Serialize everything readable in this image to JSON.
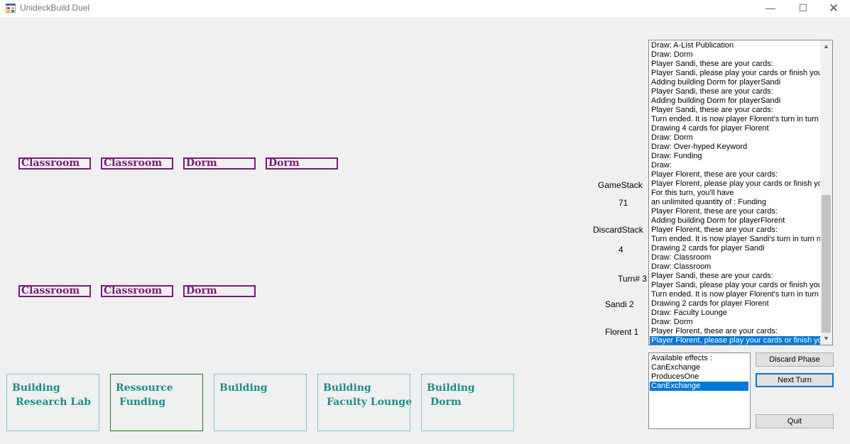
{
  "window": {
    "title": "UnideckBuild Duel",
    "minimize": "—",
    "maximize": "☐",
    "close": "✕"
  },
  "top_cards": [
    "Classroom",
    "Classroom",
    "Dorm",
    "Dorm"
  ],
  "bottom_cards": [
    "Classroom",
    "Classroom",
    "Dorm"
  ],
  "stats": {
    "game_stack_label": "GameStack",
    "game_stack_value": "71",
    "discard_stack_label": "DiscardStack",
    "discard_stack_value": "4",
    "turn": "Turn# 3",
    "player1": "Sandi 2",
    "player2": "Florent 1"
  },
  "log": [
    "Draw: A-List Publication",
    "Draw: Dorm",
    "Player Sandi, these are your cards:",
    "Player Sandi, please play your cards or finish your t",
    "Adding building Dorm for playerSandi",
    "Player Sandi, these are your cards:",
    "Adding building Dorm for playerSandi",
    "Player Sandi, these are your cards:",
    "Turn ended. It is now player Florent's turn in turn nu",
    "Drawing 4 cards for player Florent",
    "Draw: Dorm",
    "Draw: Over-hyped Keyword",
    "Draw: Funding",
    "Draw:",
    "Player Florent, these are your cards:",
    "Player Florent, please play your cards or finish your",
    "For this turn, you'll have",
    " an unlimited quantity of : Funding",
    "Player Florent, these are your cards:",
    "Adding building Dorm for playerFlorent",
    "Player Florent, these are your cards:",
    "Turn ended. It is now player Sandi's turn in turn nur",
    "Drawing 2 cards for player Sandi",
    "Draw: Classroom",
    "Draw: Classroom",
    "Player Sandi, these are your cards:",
    "Player Sandi, please play your cards or finish your t",
    "Turn ended. It is now player Florent's turn in turn nu",
    "Drawing 2 cards for player Florent",
    "Draw: Faculty Lounge",
    "Draw: Dorm",
    "Player Florent, these are your cards:",
    "Player Florent, please play your cards or finish your"
  ],
  "log_selected_index": 32,
  "effects": [
    "Available effects :",
    "CanExchange",
    "ProducesOne",
    "CanExchange"
  ],
  "effects_selected_index": 3,
  "buttons": {
    "discard": "Discard Phase",
    "next": "Next Turn",
    "quit": "Quit"
  },
  "hand": [
    {
      "title": "Building",
      "sub": "Research Lab"
    },
    {
      "title": "Ressource",
      "sub": "Funding"
    },
    {
      "title": "Building",
      "sub": ""
    },
    {
      "title": "Building",
      "sub": "Faculty Lounge"
    },
    {
      "title": "Building",
      "sub": "Dorm"
    }
  ]
}
